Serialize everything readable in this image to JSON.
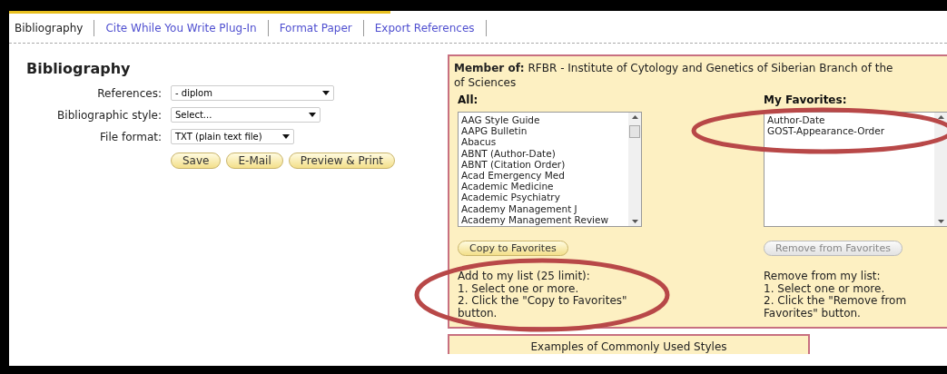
{
  "tabs": [
    {
      "label": "Bibliography",
      "selected": true
    },
    {
      "label": "Cite While You Write Plug-In",
      "selected": false
    },
    {
      "label": "Format Paper",
      "selected": false
    },
    {
      "label": "Export References",
      "selected": false
    }
  ],
  "heading": "Bibliography",
  "form": {
    "fields": [
      {
        "label": "References:",
        "value": "- diplom",
        "kind": "wide"
      },
      {
        "label": "Bibliographic style:",
        "value": "Select...",
        "kind": "medium"
      },
      {
        "label": "File format:",
        "value": "TXT (plain text file)",
        "kind": "narrow"
      }
    ],
    "buttons": [
      "Save",
      "E-Mail",
      "Preview & Print"
    ]
  },
  "panel": {
    "member_label": "Member of:",
    "member_lines": [
      "RFBR - Institute of Cytology and Genetics of Siberian Branch of the",
      "of Sciences"
    ],
    "all": {
      "title": "All:",
      "items": [
        "AAG Style Guide",
        "AAPG Bulletin",
        "Abacus",
        "ABNT (Author-Date)",
        "ABNT (Citation Order)",
        "Acad Emergency Med",
        "Academic Medicine",
        "Academic Psychiatry",
        "Academy Management J",
        "Academy Management Review"
      ],
      "button": {
        "label": "Copy to Favorites",
        "disabled": false
      },
      "instructions": [
        "Add to my list (25 limit):",
        "1. Select one or more.",
        "2. Click the \"Copy to Favorites\"",
        "button."
      ],
      "circled": true
    },
    "favorites": {
      "title": "My Favorites:",
      "items": [
        "Author-Date",
        "GOST-Appearance-Order"
      ],
      "button": {
        "label": "Remove from Favorites",
        "disabled": true
      },
      "instructions": [
        "Remove from my list:",
        "1. Select one or more.",
        "2. Click the \"Remove from",
        "Favorites\" button."
      ],
      "circled": true
    }
  },
  "examples": {
    "title": "Examples of Commonly Used Styles"
  }
}
